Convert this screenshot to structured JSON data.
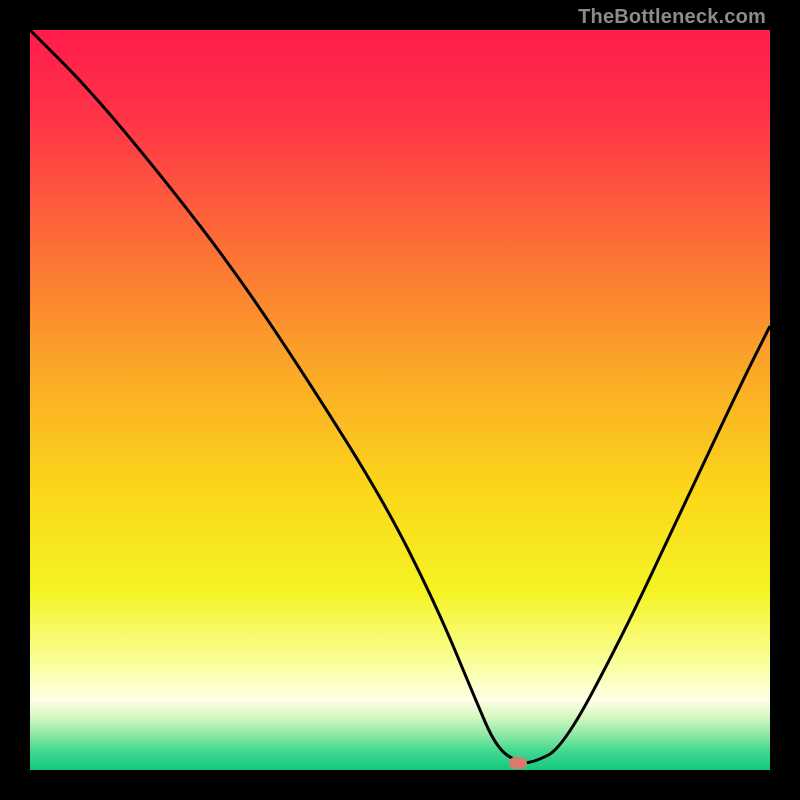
{
  "watermark": "TheBottleneck.com",
  "chart_data": {
    "type": "line",
    "title": "",
    "xlabel": "",
    "ylabel": "",
    "xlim": [
      0,
      100
    ],
    "ylim": [
      0,
      100
    ],
    "grid": false,
    "series": [
      {
        "name": "bottleneck-curve",
        "x": [
          0,
          8,
          18,
          28,
          38,
          48,
          55,
          60,
          63,
          66,
          68,
          72,
          80,
          88,
          96,
          100
        ],
        "y": [
          100,
          92,
          80,
          67,
          52,
          36,
          22,
          10,
          3,
          1,
          1,
          3,
          18,
          35,
          52,
          60
        ]
      }
    ],
    "annotations": [
      {
        "name": "optimal-marker",
        "x": 66,
        "y": 1
      }
    ],
    "background_gradient_stops": [
      {
        "pos": 0.0,
        "color": "#ff1c4b"
      },
      {
        "pos": 0.12,
        "color": "#ff3447"
      },
      {
        "pos": 0.28,
        "color": "#fd6b38"
      },
      {
        "pos": 0.45,
        "color": "#fba528"
      },
      {
        "pos": 0.62,
        "color": "#fbd61a"
      },
      {
        "pos": 0.76,
        "color": "#f4f424"
      },
      {
        "pos": 0.86,
        "color": "#faffa0"
      },
      {
        "pos": 0.905,
        "color": "#ffffe8"
      },
      {
        "pos": 0.928,
        "color": "#d6f7c0"
      },
      {
        "pos": 0.952,
        "color": "#8fe9a6"
      },
      {
        "pos": 0.975,
        "color": "#3fd88f"
      },
      {
        "pos": 1.0,
        "color": "#14c97d"
      }
    ]
  }
}
